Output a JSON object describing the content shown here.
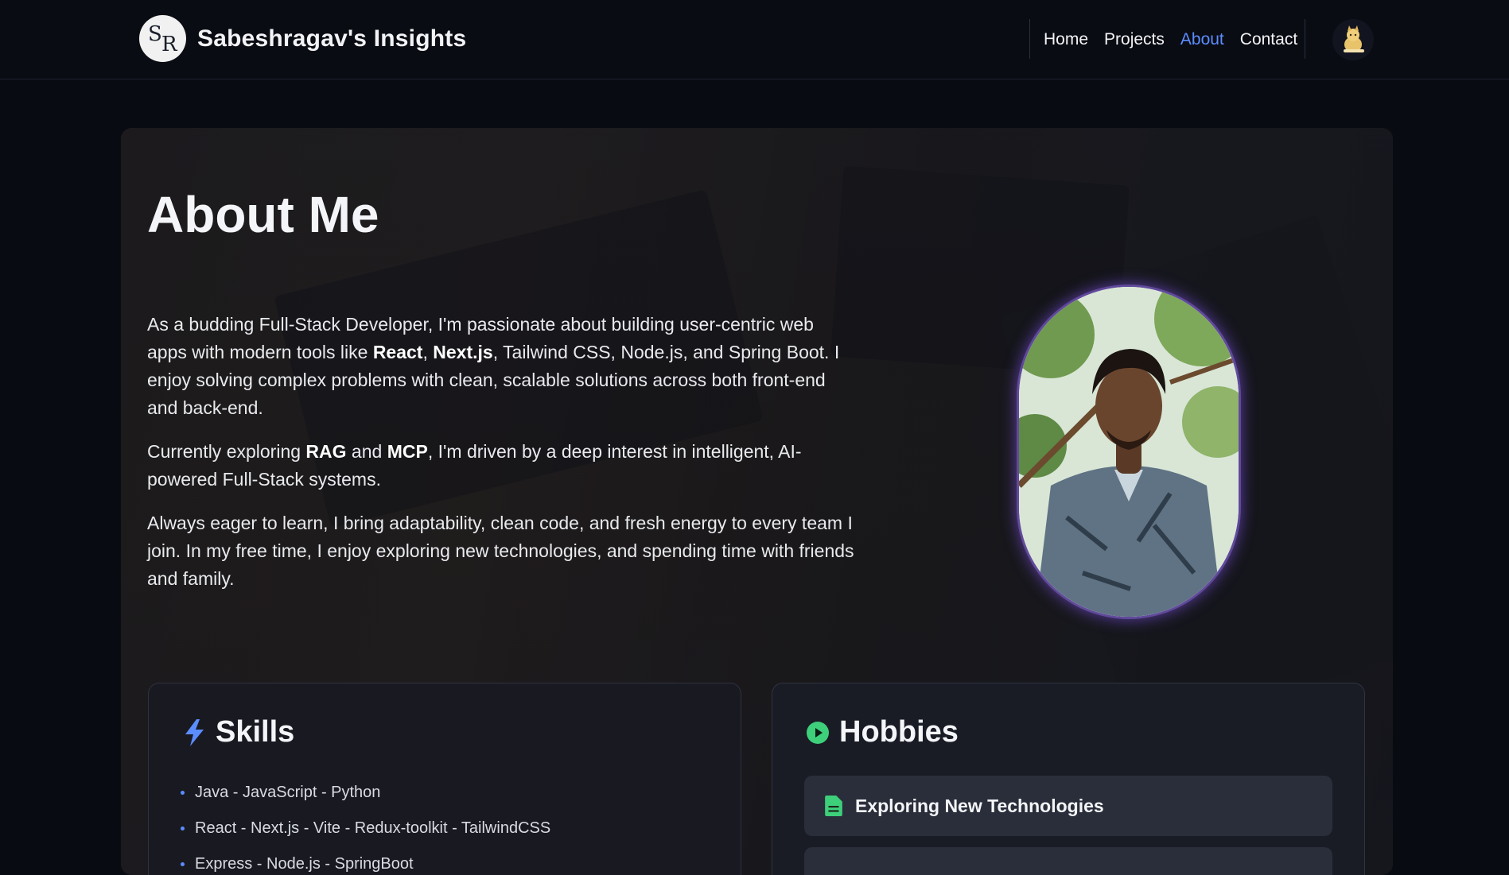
{
  "header": {
    "logo_letters": [
      "S",
      "R"
    ],
    "title": "Sabeshragav's Insights",
    "nav": [
      {
        "label": "Home",
        "active": false
      },
      {
        "label": "Projects",
        "active": false
      },
      {
        "label": "About",
        "active": true
      },
      {
        "label": "Contact",
        "active": false
      }
    ],
    "avatar_icon": "cat-avatar-icon"
  },
  "about": {
    "title": "About Me",
    "paragraphs": [
      [
        {
          "t": "As a budding Full-Stack Developer, I'm passionate about building user-centric web apps with modern tools like ",
          "b": false
        },
        {
          "t": "React",
          "b": true
        },
        {
          "t": ", ",
          "b": false
        },
        {
          "t": "Next.js",
          "b": true
        },
        {
          "t": ", Tailwind CSS, Node.js, and Spring Boot. I enjoy solving complex problems with clean, scalable solutions across both front-end and back-end.",
          "b": false
        }
      ],
      [
        {
          "t": "Currently exploring ",
          "b": false
        },
        {
          "t": "RAG",
          "b": true
        },
        {
          "t": " and ",
          "b": false
        },
        {
          "t": "MCP",
          "b": true
        },
        {
          "t": ", I'm driven by a deep interest in intelligent, AI-powered Full-Stack systems.",
          "b": false
        }
      ],
      [
        {
          "t": "Always eager to learn, I bring adaptability, clean code, and fresh energy to every team I join. In my free time, I enjoy exploring new technologies, and spending time with friends and family.",
          "b": false
        }
      ]
    ]
  },
  "skills": {
    "title": "Skills",
    "icon": "lightning-icon",
    "items": [
      "Java - JavaScript - Python",
      "React - Next.js - Vite - Redux-toolkit - TailwindCSS",
      "Express - Node.js - SpringBoot"
    ]
  },
  "hobbies": {
    "title": "Hobbies",
    "icon": "play-circle-icon",
    "items": [
      {
        "label": "Exploring New Technologies",
        "icon": "document-icon"
      },
      {
        "label": "",
        "icon": ""
      }
    ]
  },
  "colors": {
    "accent": "#5b8dff",
    "hobby_accent": "#3ecf7a",
    "portrait_glow": "#8c5aff"
  }
}
